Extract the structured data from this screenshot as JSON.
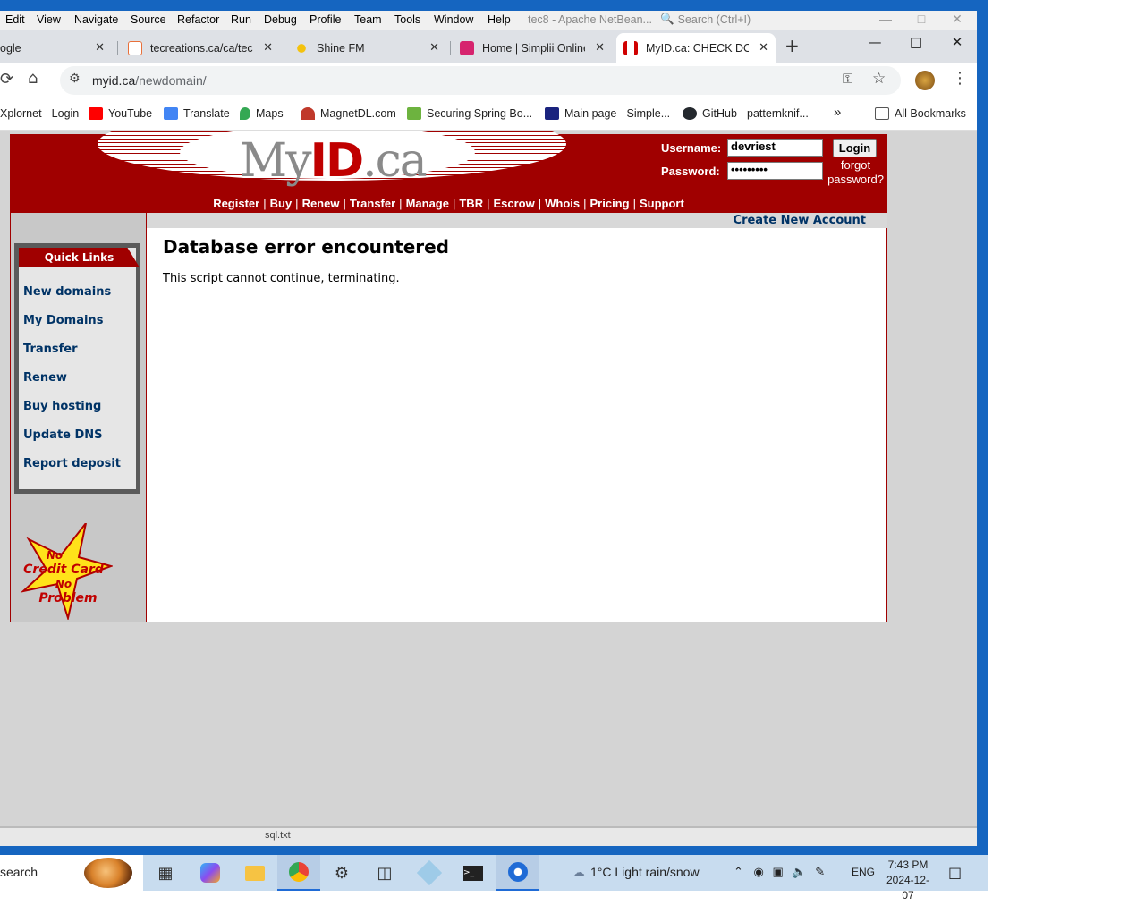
{
  "netbeans": {
    "menu": [
      "Edit",
      "View",
      "Navigate",
      "Source",
      "Refactor",
      "Run",
      "Debug",
      "Profile",
      "Team",
      "Tools",
      "Window",
      "Help"
    ],
    "title": "tec8 - Apache NetBean...",
    "search_placeholder": "Search (Ctrl+I)",
    "status_file": "sql.txt"
  },
  "browser": {
    "tabs": [
      {
        "label": "ogle",
        "favicon_color": "#4285f4"
      },
      {
        "label": "tecreations.ca/ca/tecr",
        "favicon_color": "#e8703a"
      },
      {
        "label": "Shine FM",
        "favicon_color": "#f4c20d"
      },
      {
        "label": "Home | Simplii Online",
        "favicon_color": "#d6246e"
      },
      {
        "label": "MyID.ca: CHECK DOM",
        "favicon_color": "#d00000",
        "active": true
      }
    ],
    "new_tab": "+",
    "url_host": "myid.ca",
    "url_path": "/newdomain/",
    "bookmarks": [
      {
        "label": "Xplornet - Login",
        "icon_color": "#ffffff"
      },
      {
        "label": "YouTube",
        "icon_color": "#ff0000"
      },
      {
        "label": "Translate",
        "icon_color": "#4285f4"
      },
      {
        "label": "Maps",
        "icon_color": "#34a853"
      },
      {
        "label": "MagnetDL.com",
        "icon_color": "#c0392b"
      },
      {
        "label": "Securing Spring Bo...",
        "icon_color": "#6db33f"
      },
      {
        "label": "Main page - Simple...",
        "icon_color": "#1a237e"
      },
      {
        "label": "GitHub - patternknif...",
        "icon_color": "#24292e"
      }
    ],
    "more_bookmarks": "»",
    "all_bookmarks": "All Bookmarks"
  },
  "site": {
    "logo_prefix": "My",
    "logo_id": "ID",
    "logo_suffix": ".ca",
    "username_label": "Username:",
    "username_value": "devriest",
    "password_label": "Password:",
    "password_value": "•••••••••",
    "login_button": "Login",
    "forgot_line1": "forgot",
    "forgot_line2": "password?",
    "nav": [
      "Register",
      "Buy",
      "Renew",
      "Transfer",
      "Manage",
      "TBR",
      "Escrow",
      "Whois",
      "Pricing",
      "Support"
    ],
    "create_account": "Create New Account",
    "quick_links_title": "Quick Links",
    "quick_links": [
      "New domains",
      "My Domains",
      "Transfer",
      "Renew",
      "Buy hosting",
      "Update DNS",
      "Report deposit"
    ],
    "promo_line1": "No",
    "promo_line2": "Credit Card",
    "promo_line3": "No",
    "promo_line4": "Problem",
    "error_title": "Database error encountered",
    "error_message": "This script cannot continue, terminating."
  },
  "taskbar": {
    "search_text": "search",
    "weather": "1°C  Light rain/snow",
    "lang": "ENG",
    "time": "7:43 PM",
    "date": "2024-12-07"
  }
}
